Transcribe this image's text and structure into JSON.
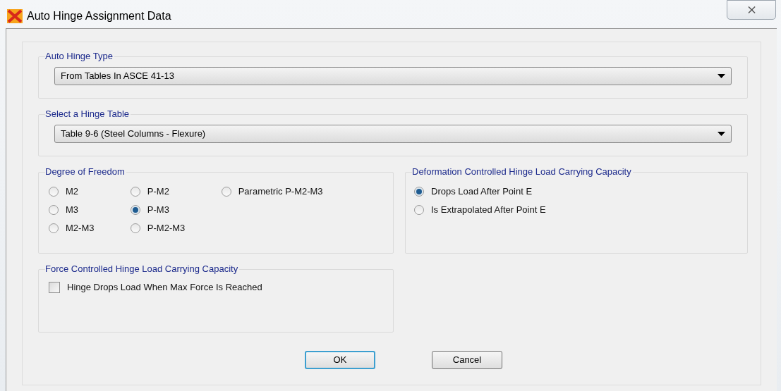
{
  "window": {
    "title": "Auto Hinge Assignment Data",
    "close": "⨯"
  },
  "auto_hinge_type": {
    "label": "Auto Hinge Type",
    "value": "From Tables In ASCE 41-13"
  },
  "hinge_table": {
    "label": "Select a Hinge Table",
    "value": "Table 9-6 (Steel Columns - Flexure)"
  },
  "degree_of_freedom": {
    "label": "Degree of Freedom",
    "options": [
      {
        "label": "M2",
        "selected": false
      },
      {
        "label": "M3",
        "selected": false
      },
      {
        "label": "M2-M3",
        "selected": false
      },
      {
        "label": "P-M2",
        "selected": false
      },
      {
        "label": "P-M3",
        "selected": true
      },
      {
        "label": "P-M2-M3",
        "selected": false
      },
      {
        "label": "Parametric P-M2-M3",
        "selected": false
      }
    ]
  },
  "deformation_capacity": {
    "label": "Deformation Controlled Hinge Load Carrying Capacity",
    "options": [
      {
        "label": "Drops Load After Point E",
        "selected": true
      },
      {
        "label": "Is Extrapolated After Point E",
        "selected": false
      }
    ]
  },
  "force_capacity": {
    "label": "Force Controlled Hinge Load Carrying Capacity",
    "checkbox": {
      "label": "Hinge Drops Load When Max Force Is Reached",
      "checked": false
    }
  },
  "buttons": [
    {
      "label": "OK",
      "default": true
    },
    {
      "label": "Cancel",
      "default": false
    }
  ]
}
